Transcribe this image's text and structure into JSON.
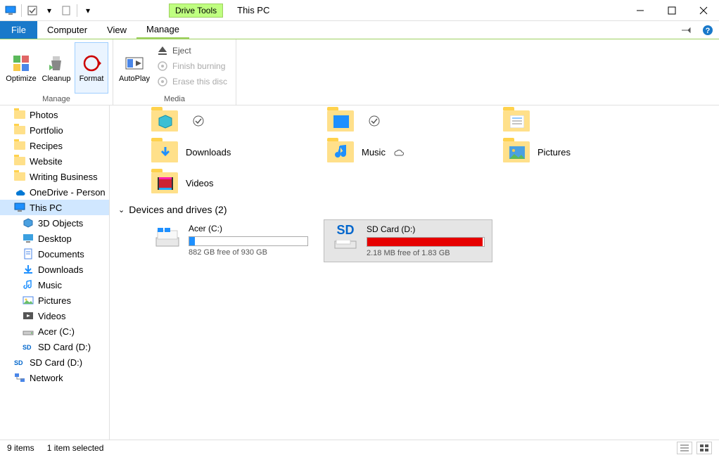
{
  "window": {
    "title": "This PC",
    "drive_tools_label": "Drive Tools"
  },
  "menubar": {
    "file": "File",
    "computer": "Computer",
    "view": "View",
    "manage": "Manage"
  },
  "ribbon": {
    "manage_group": "Manage",
    "media_group": "Media",
    "optimize": "Optimize",
    "cleanup": "Cleanup",
    "format": "Format",
    "autoplay": "AutoPlay",
    "eject": "Eject",
    "finish_burning": "Finish burning",
    "erase_disc": "Erase this disc"
  },
  "sidebar": {
    "items": [
      {
        "label": "Photos",
        "icon": "folder"
      },
      {
        "label": "Portfolio",
        "icon": "folder"
      },
      {
        "label": "Recipes",
        "icon": "folder"
      },
      {
        "label": "Website",
        "icon": "folder"
      },
      {
        "label": "Writing Business",
        "icon": "folder"
      },
      {
        "label": "OneDrive - Person",
        "icon": "onedrive"
      },
      {
        "label": "This PC",
        "icon": "pc",
        "selected": true
      },
      {
        "label": "3D Objects",
        "icon": "3d",
        "l2": true
      },
      {
        "label": "Desktop",
        "icon": "desktop",
        "l2": true
      },
      {
        "label": "Documents",
        "icon": "documents",
        "l2": true
      },
      {
        "label": "Downloads",
        "icon": "downloads",
        "l2": true
      },
      {
        "label": "Music",
        "icon": "music",
        "l2": true
      },
      {
        "label": "Pictures",
        "icon": "pictures",
        "l2": true
      },
      {
        "label": "Videos",
        "icon": "videos",
        "l2": true
      },
      {
        "label": "Acer (C:)",
        "icon": "drive",
        "l2": true
      },
      {
        "label": "SD Card (D:)",
        "icon": "sd",
        "l2": true
      },
      {
        "label": "SD Card (D:)",
        "icon": "sd"
      },
      {
        "label": "Network",
        "icon": "network"
      }
    ]
  },
  "folders": {
    "row1": [
      {
        "label": "",
        "sync": "check"
      },
      {
        "label": "",
        "sync": "check"
      },
      {
        "label": ""
      }
    ],
    "row2": [
      {
        "label": "Downloads"
      },
      {
        "label": "Music",
        "sync": "cloud"
      },
      {
        "label": "Pictures"
      }
    ],
    "row3": [
      {
        "label": "Videos"
      }
    ]
  },
  "section": {
    "header": "Devices and drives (2)"
  },
  "drives": [
    {
      "name": "Acer (C:)",
      "free_text": "882 GB free of 930 GB",
      "fill_pct": 5,
      "fill_color": "#1e90ff",
      "icon": "hdd",
      "selected": false
    },
    {
      "name": "SD Card (D:)",
      "free_text": "2.18 MB free of 1.83 GB",
      "fill_pct": 99,
      "fill_color": "#e60000",
      "icon": "sd",
      "selected": true
    }
  ],
  "status": {
    "items": "9 items",
    "selected": "1 item selected"
  }
}
